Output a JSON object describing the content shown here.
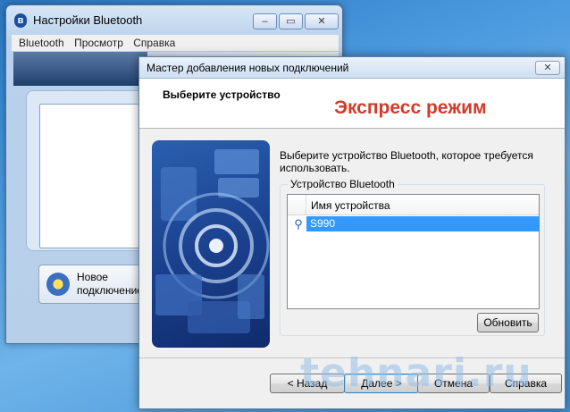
{
  "background_window": {
    "title": "Настройки Bluetooth",
    "controls": {
      "minimize": "–",
      "maximize": "▭",
      "close": "✕"
    },
    "menu": [
      "Bluetooth",
      "Просмотр",
      "Справка"
    ],
    "new_connection_label": "Новое подключение"
  },
  "wizard": {
    "title": "Мастер добавления новых подключений",
    "close": "✕",
    "step_title": "Выберите устройство",
    "mode_label": "Экспресс режим",
    "description": "Выберите устройство Bluetooth, которое требуется использовать.",
    "group_label": "Устройство Bluetooth",
    "column_header": "Имя устройства",
    "devices": [
      {
        "name": "S990",
        "selected": true,
        "icon": "bluetooth-device-icon"
      }
    ],
    "buttons": {
      "refresh": "Обновить",
      "back": "< Назад",
      "next": "Далее >",
      "cancel": "Отмена",
      "help": "Справка"
    }
  },
  "watermark": "tehnari.ru",
  "colors": {
    "mode_label": "#d23a2a",
    "selection": "#3399ff"
  }
}
